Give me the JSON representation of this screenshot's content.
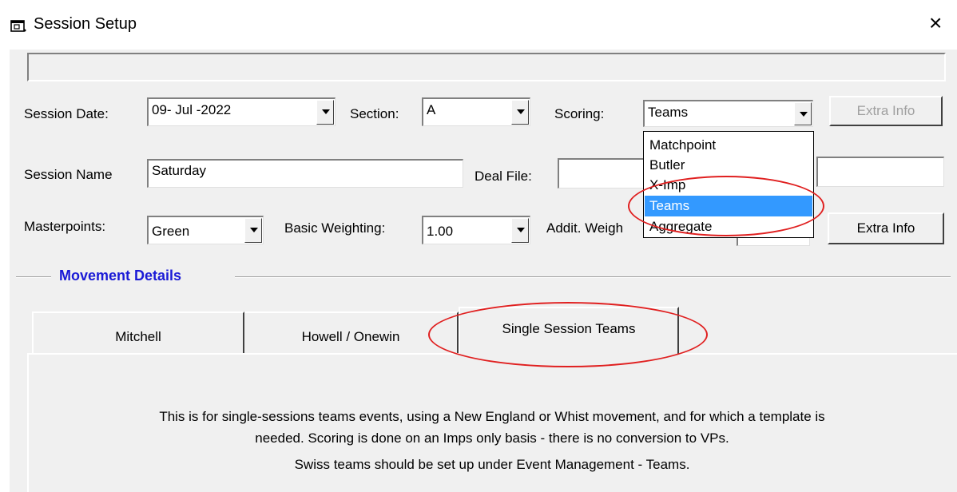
{
  "window": {
    "title": "Session Setup",
    "close_symbol": "×"
  },
  "form": {
    "session_date_label": "Session Date:",
    "session_date_value": "09- Jul -2022",
    "section_label": "Section:",
    "section_value": "A",
    "scoring_label": "Scoring:",
    "scoring_value": "Teams",
    "extra_info_top": "Extra Info",
    "session_name_label": "Session Name",
    "session_name_value": "Saturday",
    "deal_file_label": "Deal File:",
    "deal_file_value": "",
    "masterpoints_label": "Masterpoints:",
    "masterpoints_value": "Green",
    "basic_weighting_label": "Basic Weighting:",
    "basic_weighting_value": "1.00",
    "addit_weighting_label": "Addit. Weigh",
    "extra_info_bottom": "Extra Info"
  },
  "scoring_dropdown": {
    "options": [
      "Matchpoint",
      "Butler",
      "X-Imp",
      "Teams",
      "Aggregate"
    ],
    "selected": "Teams"
  },
  "movement": {
    "group_title": "Movement Details",
    "tabs": [
      "Mitchell",
      "Howell / Onewin",
      "Single Session Teams"
    ],
    "active_tab": "Single Session Teams",
    "description_line1": "This is for single-sessions teams events, using a New England or Whist movement, and for which a template is",
    "description_line2": "needed. Scoring is done on an Imps only basis - there is no conversion to VPs.",
    "description_line3": "Swiss teams should be set up under Event  Management - Teams."
  },
  "annotation_color": "#e02020",
  "selection_color": "#3399ff",
  "group_title_color": "#1a1ad6"
}
